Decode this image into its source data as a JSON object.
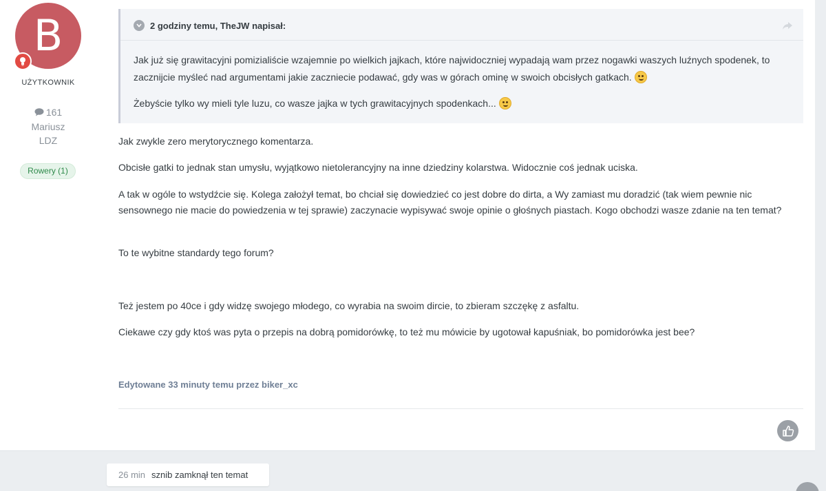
{
  "author": {
    "avatar_letter": "B",
    "rank_title": "UŻYTKOWNIK",
    "post_count": "161",
    "name": "Mariusz",
    "location": "LDZ",
    "club_badge": "Rowery (1)"
  },
  "quote": {
    "header": "2 godziny temu, TheJW napisał:",
    "paragraph1": "Jak już się grawitacyjni pomizialiście wzajemnie po wielkich jajkach, które najwidoczniej wypadają wam przez nogawki waszych luźnych spodenek, to zacznijcie myśleć nad argumentami jakie zaczniecie podawać, gdy was w górach ominę w swoich obcisłych gatkach.",
    "paragraph2": "Żebyście tylko wy mieli tyle luzu, co wasze jajka w tych grawitacyjnych spodenkach..."
  },
  "body": {
    "p1": "Jak zwykle zero merytorycznego komentarza.",
    "p2": "Obcisłe gatki to jednak stan umysłu,  wyjątkowo nietolerancyjny na inne dziedziny kolarstwa.  Widocznie coś jednak uciska.",
    "p3": "A tak w ogóle to wstydźcie się. Kolega założył temat, bo chciał się dowiedzieć co jest dobre do dirta, a Wy zamiast mu doradzić (tak wiem pewnie nic sensownego nie macie do powiedzenia w tej sprawie) zaczynacie wypisywać swoje opinie o głośnych piastach. Kogo obchodzi wasze zdanie na ten temat?",
    "p4": "To te wybitne standardy tego forum?",
    "p5": "Też jestem po 40ce i gdy widzę swojego młodego,  co wyrabia na swoim dircie, to zbieram szczękę z asfaltu.",
    "p6": "Ciekawe czy gdy ktoś was pyta o przepis na dobrą pomidorówkę, to też mu mówicie by ugotował kapuśniak, bo pomidorówka jest bee?"
  },
  "edited_note": "Edytowane 33 minuty temu przez biker_xc",
  "event": {
    "time": "26 min",
    "text": "sznib zamknął ten temat"
  },
  "icons": {
    "rank": "lightbulb-icon",
    "posts": "comment-icon",
    "quote_toggle": "chevron-down-icon",
    "share": "share-icon",
    "like": "thumbs-up-icon",
    "scroll": "arrow-up-icon"
  },
  "colors": {
    "avatar_bg": "#c75b62",
    "rank_badge": "#e24a43",
    "club_badge_text": "#2f8a4b",
    "edited_note": "#6f7f95"
  }
}
